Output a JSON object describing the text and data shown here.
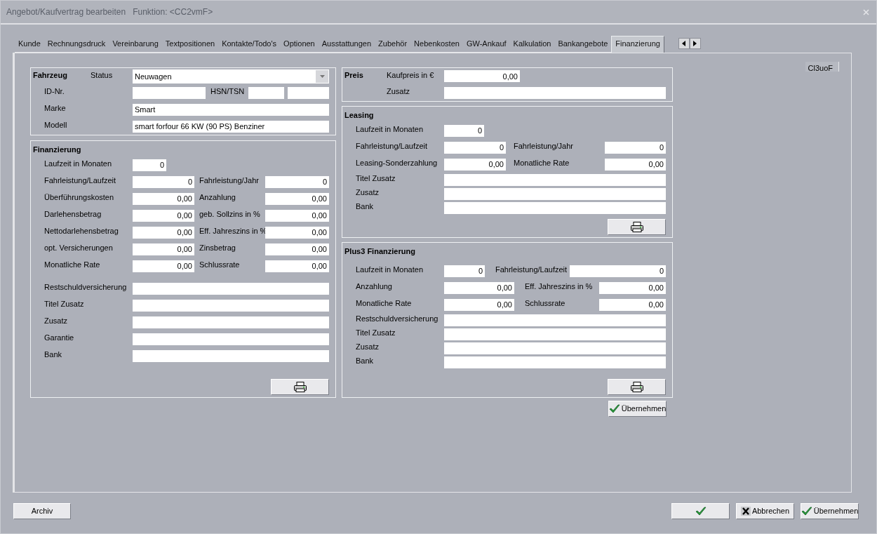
{
  "window": {
    "title": "Angebot/Kaufvertrag bearbeiten",
    "subtitle": "Funktion: <CC2vmF>"
  },
  "tabs": [
    {
      "label": "Kunde",
      "selected": false
    },
    {
      "label": "Rechnungsdruck",
      "selected": false
    },
    {
      "label": "Vereinbarung",
      "selected": false
    },
    {
      "label": "Textpositionen",
      "selected": false
    },
    {
      "label": "Kontakte/Todo's",
      "selected": false
    },
    {
      "label": "Optionen",
      "selected": false
    },
    {
      "label": "Ausstattungen",
      "selected": false
    },
    {
      "label": "Zubehör",
      "selected": false
    },
    {
      "label": "Nebenkosten",
      "selected": false
    },
    {
      "label": "GW-Ankauf",
      "selected": false
    },
    {
      "label": "Kalkulation",
      "selected": false
    },
    {
      "label": "Bankangebote",
      "selected": false
    },
    {
      "label": "Finanzierung",
      "selected": true
    }
  ],
  "corner_label": "Cl3uoF",
  "groups_left": [
    {
      "kind": "vehicle",
      "title": "Fahrzeug",
      "rows": [
        {
          "label": "Status",
          "fields": [
            {
              "kind": "select",
              "value": "Neuwagen"
            }
          ]
        },
        {
          "label": "ID-Nr.",
          "fields": [
            {
              "kind": "medium"
            }
          ],
          "label2": "HSN/TSN",
          "fields2": [
            {
              "kind": "code"
            },
            {
              "kind": "text"
            }
          ]
        },
        {
          "label": "Marke",
          "fields": [
            {
              "kind": "text",
              "value": "Smart"
            }
          ]
        },
        {
          "label": "Modell",
          "fields": [
            {
              "kind": "text",
              "value": "smart forfour 66 KW (90 PS) Benziner"
            }
          ]
        }
      ]
    },
    {
      "kind": "financing",
      "title": "Finanzierung",
      "print_button": true,
      "rows": [
        {
          "label": "Laufzeit in Monaten",
          "fields": [
            {
              "kind": "short",
              "value": "0"
            }
          ]
        },
        {
          "label": "Fahrleistung/Laufzeit",
          "fields": [
            {
              "kind": "number",
              "value": "0"
            }
          ],
          "label2": "Fahrleistung/Jahr",
          "fields2": [
            {
              "kind": "number",
              "value": "0"
            }
          ]
        },
        {
          "label": "Überführungskosten",
          "fields": [
            {
              "kind": "number",
              "value": "0,00"
            }
          ],
          "label2": "Anzahlung",
          "fields2": [
            {
              "kind": "number",
              "value": "0,00"
            }
          ]
        },
        {
          "label": "Darlehensbetrag",
          "fields": [
            {
              "kind": "number",
              "value": "0,00"
            }
          ],
          "label2": "geb. Sollzins in %",
          "fields2": [
            {
              "kind": "number",
              "value": "0,00"
            }
          ]
        },
        {
          "label": "Nettodarlehensbetrag",
          "fields": [
            {
              "kind": "number",
              "value": "0,00"
            }
          ],
          "label2": "Eff. Jahreszins in %",
          "fields2": [
            {
              "kind": "number",
              "value": "0,00"
            }
          ]
        },
        {
          "label": "opt. Versicherungen",
          "fields": [
            {
              "kind": "number",
              "value": "0,00"
            }
          ],
          "label2": "Zinsbetrag",
          "fields2": [
            {
              "kind": "number",
              "value": "0,00"
            }
          ]
        },
        {
          "label": "Monatliche Rate",
          "fields": [
            {
              "kind": "number",
              "value": "0,00"
            }
          ],
          "label2": "Schlussrate",
          "fields2": [
            {
              "kind": "number",
              "value": "0,00"
            }
          ]
        },
        {
          "label": "Restschuldversicherung",
          "fields": [
            {
              "kind": "text"
            }
          ]
        },
        {
          "label": "Titel Zusatz",
          "fields": [
            {
              "kind": "text"
            }
          ]
        },
        {
          "label": "Zusatz",
          "fields": [
            {
              "kind": "text"
            }
          ]
        },
        {
          "label": "Garantie",
          "fields": [
            {
              "kind": "text"
            }
          ]
        },
        {
          "label": "Bank",
          "fields": [
            {
              "kind": "text"
            }
          ]
        }
      ]
    }
  ],
  "groups_right": [
    {
      "kind": "price",
      "title": "Preis",
      "rows": [
        {
          "label": "Kaufpreis in €",
          "fields": [
            {
              "kind": "number",
              "value": "0,00"
            }
          ]
        },
        {
          "label": "Zusatz",
          "fields": [
            {
              "kind": "text"
            }
          ]
        }
      ]
    },
    {
      "kind": "leasing",
      "title": "Leasing",
      "print_button": true,
      "rows": [
        {
          "label": "Laufzeit in Monaten",
          "fields": [
            {
              "kind": "short",
              "value": "0"
            }
          ]
        },
        {
          "label": "Fahrleistung/Laufzeit",
          "fields": [
            {
              "kind": "number",
              "value": "0"
            }
          ],
          "label2": "Fahrleistung/Jahr",
          "fields2": [
            {
              "kind": "number",
              "value": "0"
            }
          ]
        },
        {
          "label": "Leasing-Sonderzahlung",
          "fields": [
            {
              "kind": "number",
              "value": "0,00"
            }
          ],
          "label2": "Monatliche Rate",
          "fields2": [
            {
              "kind": "number",
              "value": "0,00"
            }
          ]
        },
        {
          "label": "Titel Zusatz",
          "fields": [
            {
              "kind": "text"
            }
          ]
        },
        {
          "label": "Zusatz",
          "fields": [
            {
              "kind": "text"
            }
          ]
        },
        {
          "label": "Bank",
          "fields": [
            {
              "kind": "text"
            }
          ]
        }
      ]
    },
    {
      "kind": "plus3",
      "title": "Plus3 Finanzierung",
      "print_button": true,
      "rows": [
        {
          "label": "Laufzeit in Monaten",
          "fields": [
            {
              "kind": "short",
              "value": "0"
            }
          ],
          "label2": "Fahrleistung/Laufzeit",
          "fields2": [
            {
              "kind": "number",
              "value": "0"
            }
          ]
        },
        {
          "label": "Anzahlung",
          "fields": [
            {
              "kind": "number",
              "value": "0,00"
            }
          ],
          "label2": "Eff. Jahreszins in %",
          "fields2": [
            {
              "kind": "number",
              "value": "0,00"
            }
          ]
        },
        {
          "label": "Monatliche Rate",
          "fields": [
            {
              "kind": "number",
              "value": "0,00"
            }
          ],
          "label2": "Schlussrate",
          "fields2": [
            {
              "kind": "number",
              "value": "0,00"
            }
          ]
        },
        {
          "label": "Restschuldversicherung",
          "fields": [
            {
              "kind": "text"
            }
          ]
        },
        {
          "label": "Titel Zusatz",
          "fields": [
            {
              "kind": "text"
            }
          ]
        },
        {
          "label": "Zusatz",
          "fields": [
            {
              "kind": "text"
            }
          ]
        },
        {
          "label": "Bank",
          "fields": [
            {
              "kind": "text"
            }
          ]
        }
      ]
    }
  ],
  "apply_button": "Übernehmen",
  "footer": {
    "archive": "Archiv",
    "cancel": "Abbrechen",
    "apply": "Übernehmen"
  }
}
